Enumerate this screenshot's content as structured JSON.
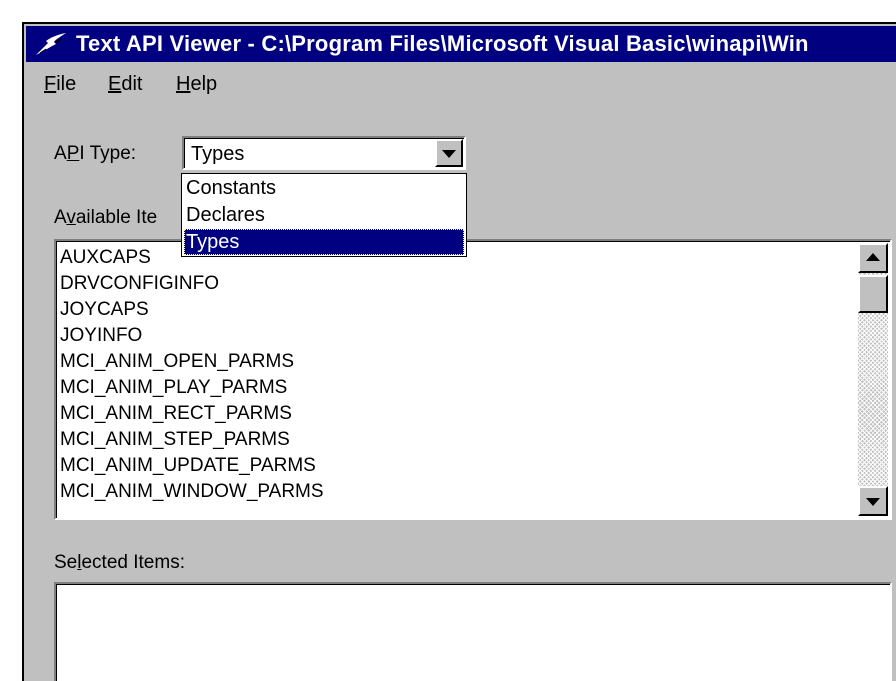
{
  "window": {
    "title": "Text API Viewer - C:\\Program Files\\Microsoft Visual Basic\\winapi\\Win"
  },
  "menu": [
    {
      "pre": "",
      "key": "F",
      "post": "ile"
    },
    {
      "pre": "",
      "key": "E",
      "post": "dit"
    },
    {
      "pre": "",
      "key": "H",
      "post": "elp"
    }
  ],
  "api_type": {
    "label_pre": "A",
    "label_key": "P",
    "label_post": "I Type:",
    "selected": "Types",
    "options": [
      "Constants",
      "Declares",
      "Types"
    ]
  },
  "available": {
    "label_pre": "A",
    "label_key": "v",
    "label_post": "ailable Ite",
    "items": [
      "AUXCAPS",
      "DRVCONFIGINFO",
      "JOYCAPS",
      "JOYINFO",
      "MCI_ANIM_OPEN_PARMS",
      "MCI_ANIM_PLAY_PARMS",
      "MCI_ANIM_RECT_PARMS",
      "MCI_ANIM_STEP_PARMS",
      "MCI_ANIM_UPDATE_PARMS",
      "MCI_ANIM_WINDOW_PARMS"
    ]
  },
  "selected_items": {
    "label_pre": "Se",
    "label_key": "l",
    "label_post": "ected Items:"
  },
  "colors": {
    "titlebar": "#000080",
    "face": "#c0c0c0",
    "highlight": "#000080"
  }
}
